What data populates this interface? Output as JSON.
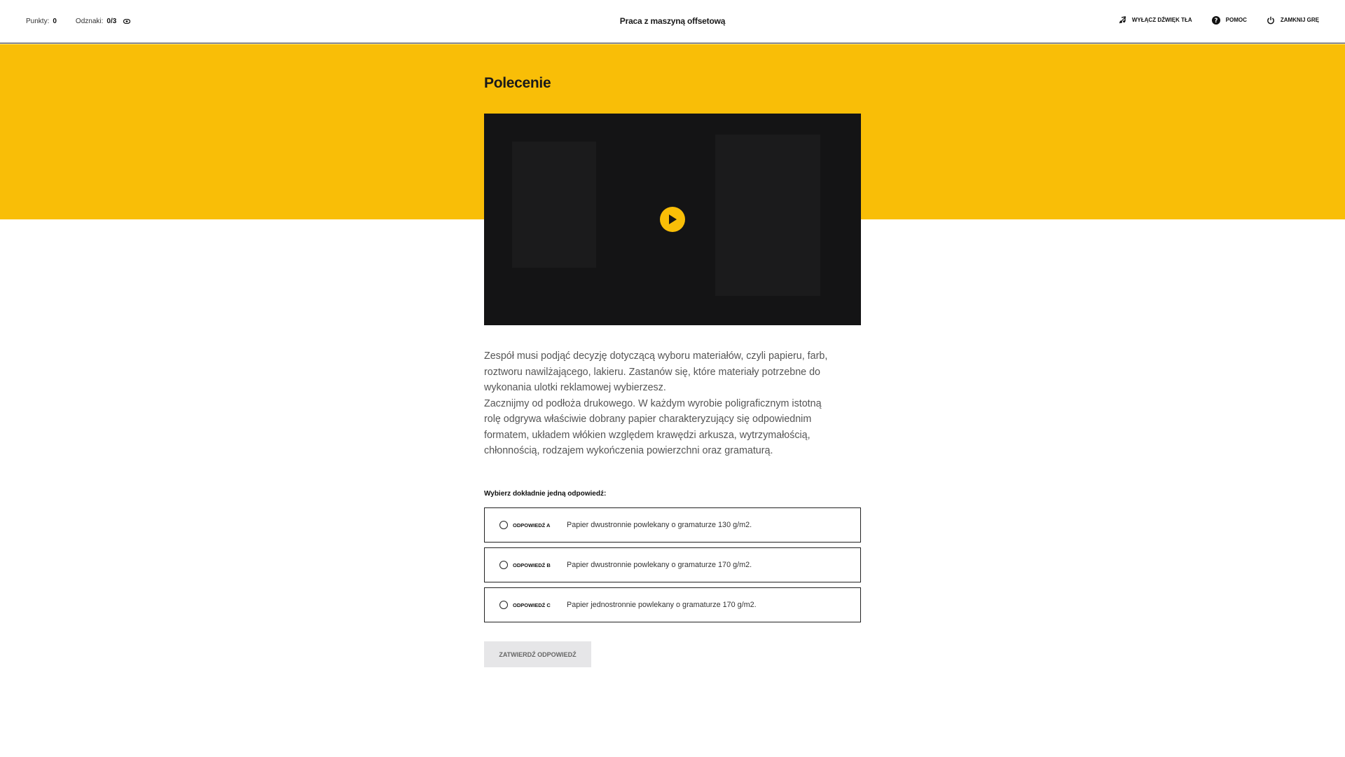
{
  "header": {
    "points_label": "Punkty:",
    "points_value": "0",
    "badges_label": "Odznaki:",
    "badges_value": "0/3",
    "title": "Praca z maszyną offsetową",
    "actions": [
      {
        "label": "WYŁĄCZ DŹWIĘK TŁA",
        "icon": "music-mute-icon"
      },
      {
        "label": "POMOC",
        "icon": "help-icon"
      },
      {
        "label": "ZAMKNIJ GRĘ",
        "icon": "power-icon"
      }
    ]
  },
  "main": {
    "heading": "Polecenie",
    "video": {
      "icon": "play-icon",
      "accent": "#f9be07"
    },
    "description": [
      "Zespół musi podjąć decyzję dotyczącą wyboru materiałów, czyli papieru, farb, roztworu nawilżającego, lakieru. Zastanów się, które materiały potrzebne do wykonania ulotki reklamowej wybierzesz.",
      "Zacznijmy od podłoża drukowego. W każdym wyrobie poligraficznym istotną rolę odgrywa właściwie dobrany papier charakteryzujący się odpowiednim formatem, układem włókien względem krawędzi arkusza, wytrzymałością, chłonnością, rodzajem wykończenia powierzchni oraz gramaturą."
    ],
    "prompt": "Wybierz dokładnie jedną odpowiedź:",
    "answers": [
      {
        "tag": "ODPOWIEDŹ A",
        "text": "Papier dwustronnie powlekany o gramaturze 130 g/m2."
      },
      {
        "tag": "ODPOWIEDŹ B",
        "text": "Papier dwustronnie powlekany o gramaturze 170 g/m2."
      },
      {
        "tag": "ODPOWIEDŹ C",
        "text": "Papier jednostronnie powlekany o gramaturze 170 g/m2."
      }
    ],
    "confirm_label": "ZATWIERDŹ ODPOWIEDŹ"
  },
  "colors": {
    "accent": "#f9be07",
    "video_bg": "#141415",
    "button_disabled": "#e6e6e8"
  }
}
